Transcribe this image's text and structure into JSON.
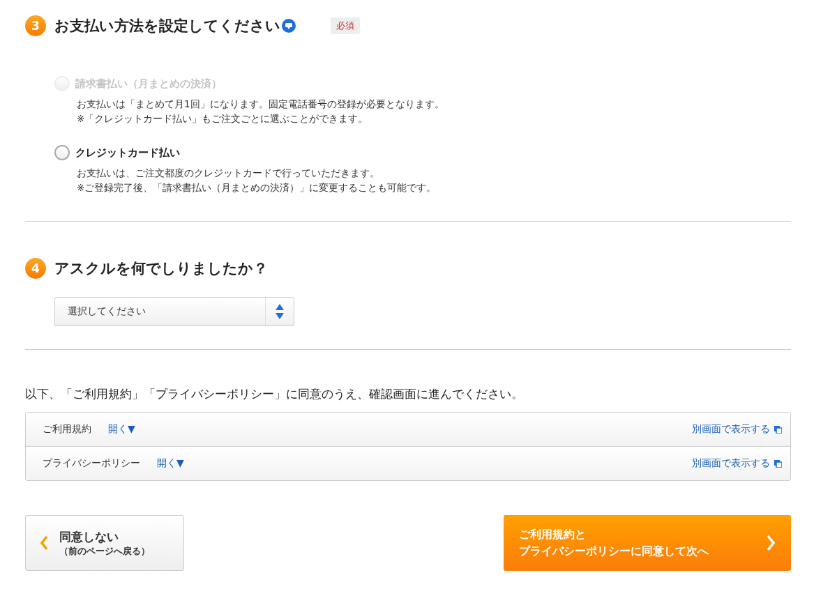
{
  "payment_section": {
    "number": "3",
    "title": "お支払い方法を設定してください",
    "required_badge": "必須",
    "options": [
      {
        "label": "請求書払い（月まとめの決済）",
        "selected": false,
        "disabled": true,
        "description": [
          "お支払いは「まとめて月1回」になります。固定電話番号の登録が必要となります。",
          "※「クレジットカード払い」もご注文ごとに選ぶことができます。"
        ]
      },
      {
        "label": "クレジットカード払い",
        "selected": false,
        "disabled": false,
        "description": [
          "お支払いは、ご注文都度のクレジットカードで行っていただきます。",
          "※ご登録完了後、「請求書払い（月まとめの決済）」に変更することも可能です。"
        ]
      }
    ]
  },
  "source_section": {
    "number": "4",
    "title": "アスクルを何でしりましたか？",
    "select": {
      "value": "選択してください"
    }
  },
  "agreement": {
    "text": "以下、「ご利用規約」「プライバシーポリシー」に同意のうえ、確認画面に進んでください。",
    "documents": [
      {
        "name": "ご利用規約",
        "toggle": "開く▼",
        "external_link": "別画面で表示する"
      },
      {
        "name": "プライバシーポリシー",
        "toggle": "開く▼",
        "external_link": "別画面で表示する"
      }
    ]
  },
  "buttons": {
    "back": {
      "line1": "同意しない",
      "line2": "（前のページへ戻る）"
    },
    "next": {
      "line1": "ご利用規約と",
      "line2": "プライバシーポリシーに同意して次へ"
    }
  }
}
